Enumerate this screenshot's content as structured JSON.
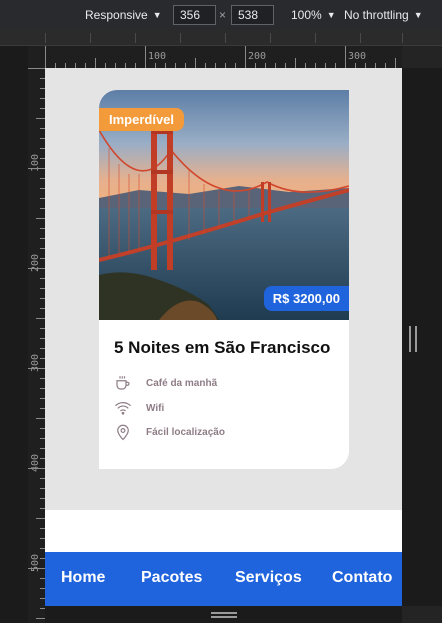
{
  "devtools": {
    "device_mode": "Responsive",
    "width": "356",
    "height": "538",
    "times": "×",
    "zoom": "100%",
    "throttling": "No throttling"
  },
  "rulers": {
    "horizontal_labels": [
      "100",
      "200",
      "300"
    ],
    "vertical_labels": [
      "100",
      "200",
      "300",
      "400",
      "500"
    ]
  },
  "card": {
    "badge": "Imperdível",
    "price": "R$ 3200,00",
    "title": "5 Noites em São Francisco",
    "amenities": [
      {
        "icon": "coffee-cup-icon",
        "label": "Café da manhã"
      },
      {
        "icon": "wifi-icon",
        "label": "Wifi"
      },
      {
        "icon": "location-pin-icon",
        "label": "Fácil localização"
      }
    ]
  },
  "nav": {
    "items": [
      "Home",
      "Pacotes",
      "Serviços",
      "Contato"
    ]
  },
  "colors": {
    "accent_blue": "#1f63dd",
    "badge_orange": "#f39a3a",
    "amenity_text": "#8e7d86"
  }
}
